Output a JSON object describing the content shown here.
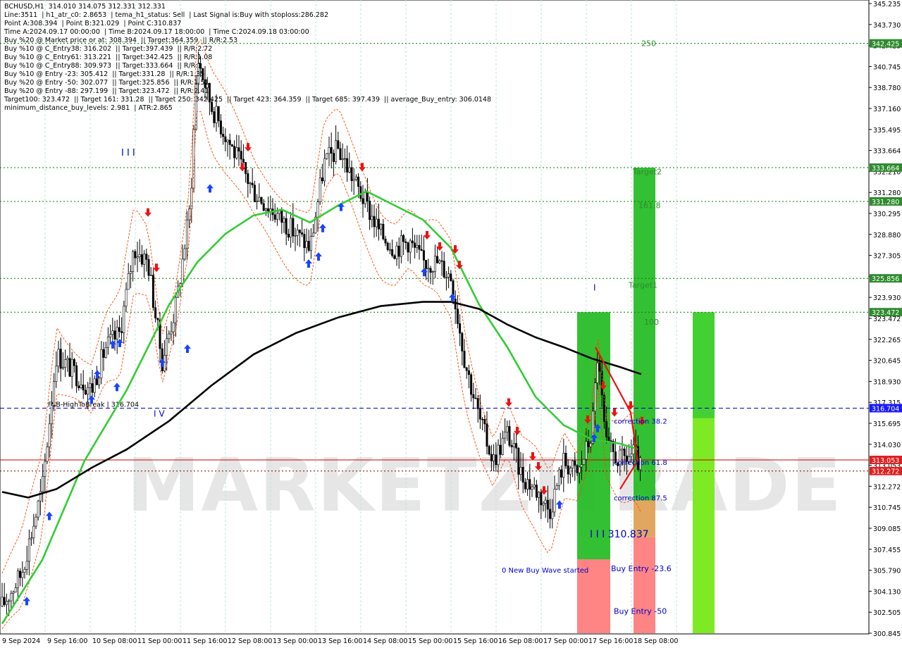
{
  "info_lines": [
    "BCHUSD,H1  314.010 314.075 312.331 312.331",
    "Line:3511  | h1_atr_c0: 2.8653  | tema_h1_status: Sell  | Last Signal is:Buy with stoploss:286.282",
    "Point A:308.394  | Point B:321.029  | Point C:310.837",
    "Time A:2024.09.17 00:00:00  | Time B:2024.09.17 18:00:00  | Time C:2024.09.18 03:00:00",
    "Buy %20 @ Market price or at: 308.394  || Target:364.359  || R/R:2.53",
    "Buy %10 @ C_Entry38: 316.202  || Target:397.439  || R/R:2.72",
    "Buy %10 @ C_Entry61: 313.221  || Target:342.425  || R/R:1.08",
    "Buy %10 @ C_Entry88: 309.973  || Target:333.664  || R/R:1",
    "Buy %10 @ Entry -23: 305.412  || Target:331.28  || R/R:1.35",
    "Buy %20 @ Entry -50: 302.077  || Target:325.856  || R/R:1.51",
    "Buy %20 @ Entry -88: 297.199  || Target:323.472  || R/R:2.41",
    "Target100: 323.472  || Target 161: 331.28  || Target 250: 342.425  || Target 423: 364.359  || Target 685: 397.439  || average_Buy_entry: 306.0148",
    "minimum_distance_buy_levels: 2.981  | ATR:2.865"
  ],
  "chart_data": {
    "type": "candlestick",
    "symbol": "BCHUSD",
    "timeframe": "H1",
    "ylim": [
      300.835,
      345.235
    ],
    "y_ticks": [
      345.235,
      343.73,
      342.24,
      340.745,
      339.255,
      337.76,
      336.265,
      334.775,
      333.28,
      331.785,
      330.295,
      328.8,
      327.305,
      325.815,
      324.32,
      322.83,
      321.335,
      319.84,
      318.345,
      316.855,
      315.36,
      313.865,
      312.375,
      310.88,
      309.385,
      307.895,
      306.4,
      304.905,
      303.41,
      301.92
    ],
    "y_tick_labels": [
      "345.235",
      "343.730",
      "342.425",
      "340.745",
      "338.780",
      "337.160",
      "335.495",
      "333.664",
      "332.210",
      "331.280",
      "330.295",
      "328.880",
      "327.305",
      "325.856",
      "323.930",
      "323.472",
      "322.265",
      "320.645",
      "318.930",
      "317.315",
      "315.695",
      "314.030",
      "313.053",
      "312.272",
      "310.745",
      "309.085",
      "307.455",
      "305.790",
      "304.130",
      "302.505",
      "300.845"
    ],
    "x_tick_labels": [
      "9 Sep 2024",
      "9 Sep 16:00",
      "10 Sep 08:00",
      "11 Sep 00:00",
      "11 Sep 16:00",
      "12 Sep 08:00",
      "13 Sep 00:00",
      "13 Sep 16:00",
      "14 Sep 08:00",
      "15 Sep 00:00",
      "15 Sep 16:00",
      "16 Sep 08:00",
      "17 Sep 00:00",
      "17 Sep 16:00",
      "18 Sep 08:00"
    ],
    "levels": [
      {
        "name": "Target 250",
        "value": 342.425,
        "color": "#008000",
        "style": "dotted",
        "label": "250"
      },
      {
        "name": "Target2",
        "value": 333.664,
        "color": "#008000",
        "style": "dotted",
        "label": "Target2"
      },
      {
        "name": "161.8",
        "value": 331.28,
        "color": "#008000",
        "style": "dotted",
        "label": "161.8"
      },
      {
        "name": "Target1",
        "value": 325.856,
        "color": "#008000",
        "style": "dotted",
        "label": "Target1"
      },
      {
        "name": "100",
        "value": 323.472,
        "color": "#008000",
        "style": "dotted",
        "label": "100"
      },
      {
        "name": "FSB-HighToBreak",
        "value": 316.704,
        "color": "#0000cc",
        "style": "dashed",
        "label": "FSB-HighToBreak | 316.704"
      },
      {
        "name": "price",
        "value": 313.053,
        "color": "#cc0000",
        "style": "solid",
        "label": ""
      },
      {
        "name": "current",
        "value": 312.272,
        "color": "#800000",
        "style": "dotted",
        "label": ""
      }
    ],
    "price_badges": [
      {
        "value": 342.425,
        "label": "342.425",
        "color": "#2e8b2e"
      },
      {
        "value": 333.664,
        "label": "333.664",
        "color": "#2e8b2e"
      },
      {
        "value": 331.28,
        "label": "331.280",
        "color": "#2e8b2e"
      },
      {
        "value": 325.856,
        "label": "325.856",
        "color": "#2e8b2e"
      },
      {
        "value": 323.472,
        "label": "323.472",
        "color": "#2e8b2e"
      },
      {
        "value": 316.704,
        "label": "316.704",
        "color": "#1a1aff"
      },
      {
        "value": 313.053,
        "label": "313.053",
        "color": "#e02020"
      },
      {
        "value": 312.272,
        "label": "312.272",
        "color": "#e02020"
      }
    ],
    "annotations": [
      {
        "text": "250",
        "color": "#2e8b2e"
      },
      {
        "text": "Target2",
        "color": "#2e8b2e"
      },
      {
        "text": "161.8",
        "color": "#2e8b2e"
      },
      {
        "text": "Target1",
        "color": "#2e8b2e"
      },
      {
        "text": "100",
        "color": "#2e8b2e"
      },
      {
        "text": "correction 38.2",
        "color": "#0000cc"
      },
      {
        "text": "correction 61.8",
        "color": "#0000cc"
      },
      {
        "text": "correction 87.5",
        "color": "#0000cc"
      },
      {
        "text": "I I I 310.837",
        "color": "#0000cc"
      },
      {
        "text": "Buy Entry -23.6",
        "color": "#0000cc"
      },
      {
        "text": "Buy Entry -50",
        "color": "#0000cc"
      },
      {
        "text": "0 New Buy Wave started",
        "color": "#0000cc"
      },
      {
        "text": "I I I",
        "color": "#0000cc"
      },
      {
        "text": "I V",
        "color": "#0000cc"
      },
      {
        "text": "I",
        "color": "#0000cc"
      }
    ],
    "watermark": "MARKETZITRADE",
    "colors": {
      "bull": "#000000",
      "bear": "#000000",
      "ma_fast": "#33cc33",
      "ma_slow": "#000000",
      "envelope": "#ff4500",
      "target_zone": "#22bb22",
      "entry_zone": "#ff6666",
      "up_arrow": "#1a44ff",
      "down_arrow": "#ee1111"
    }
  }
}
